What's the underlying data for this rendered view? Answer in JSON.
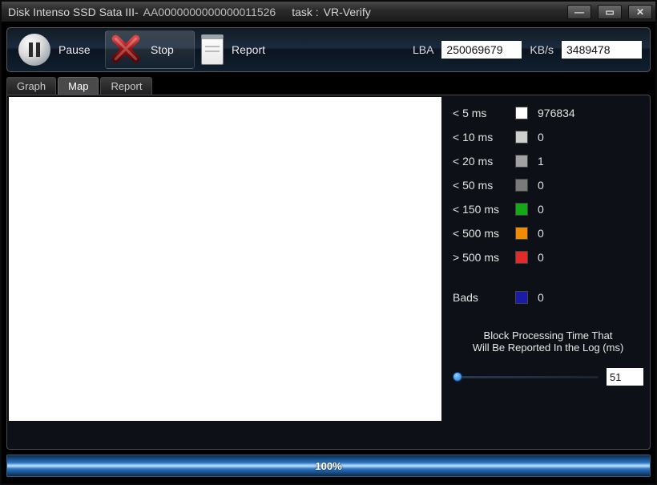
{
  "window": {
    "title_prefix": "Disk Intenso SSD Sata III-",
    "serial": "AA0000000000000011526",
    "task_label": "task : ",
    "task": "VR-Verify"
  },
  "toolbar": {
    "pause_label": "Pause",
    "stop_label": "Stop",
    "report_label": "Report",
    "lba_label": "LBA",
    "lba_value": "250069679",
    "kbs_label": "KB/s",
    "kbs_value": "3489478"
  },
  "tabs": [
    {
      "id": "graph",
      "label": "Graph",
      "active": false
    },
    {
      "id": "map",
      "label": "Map",
      "active": true
    },
    {
      "id": "report",
      "label": "Report",
      "active": false
    }
  ],
  "legend": [
    {
      "label": "< 5 ms",
      "color": "#ffffff",
      "count": "976834"
    },
    {
      "label": "< 10 ms",
      "color": "#cfcfcf",
      "count": "0"
    },
    {
      "label": "< 20 ms",
      "color": "#a2a2a2",
      "count": "1"
    },
    {
      "label": "< 50 ms",
      "color": "#7a7a7a",
      "count": "0"
    },
    {
      "label": "< 150 ms",
      "color": "#16a916",
      "count": "0"
    },
    {
      "label": "< 500 ms",
      "color": "#f08c00",
      "count": "0"
    },
    {
      "label": "> 500 ms",
      "color": "#e12b2b",
      "count": "0"
    }
  ],
  "bads": {
    "label": "Bads",
    "color": "#1b1ba8",
    "count": "0"
  },
  "block_msg_1": "Block Processing Time That",
  "block_msg_2": "Will Be Reported In the Log (ms)",
  "slider_value": "51",
  "progress": {
    "percent": "100%"
  }
}
